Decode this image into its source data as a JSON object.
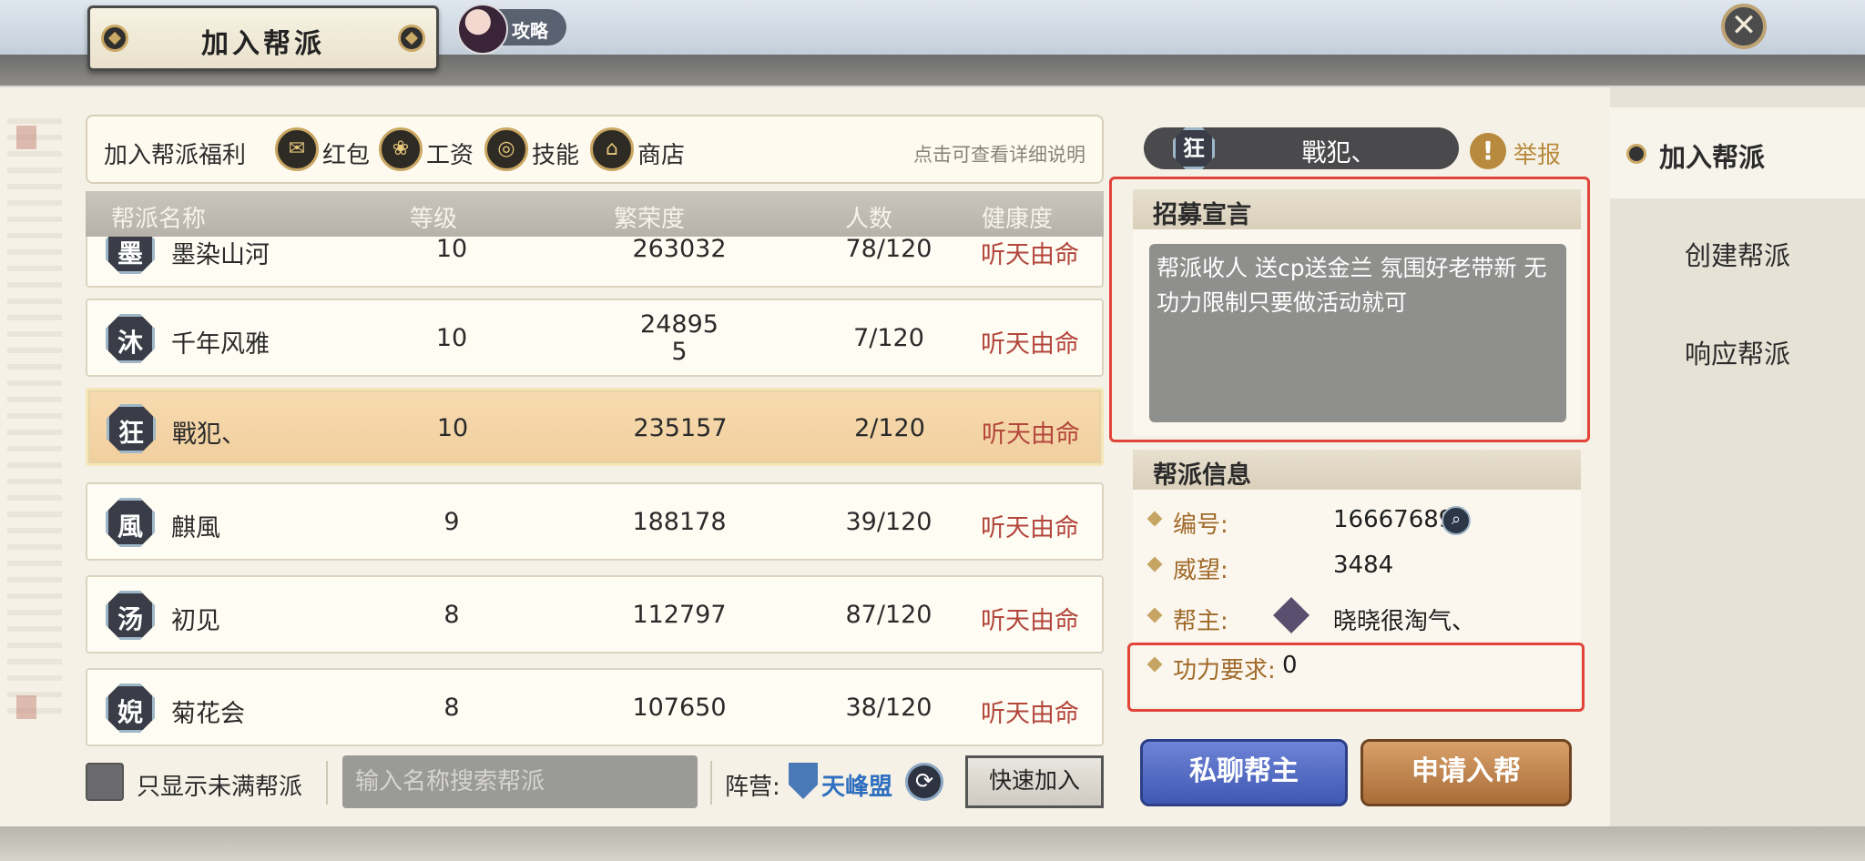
{
  "header": {
    "title": "加入帮派",
    "guide_label": "攻略",
    "close_symbol": "✕"
  },
  "benefits": {
    "label": "加入帮派福利",
    "items": [
      {
        "icon": "red-envelope-icon",
        "glyph": "✉",
        "label": "红包"
      },
      {
        "icon": "money-bag-icon",
        "glyph": "❀",
        "label": "工资"
      },
      {
        "icon": "skill-swirl-icon",
        "glyph": "◎",
        "label": "技能"
      },
      {
        "icon": "shop-icon",
        "glyph": "⌂",
        "label": "商店"
      }
    ],
    "hint": "点击可查看详细说明"
  },
  "list": {
    "columns": [
      "帮派名称",
      "等级",
      "繁荣度",
      "人数",
      "健康度"
    ],
    "rows": [
      {
        "emblem": "墨",
        "name": "墨染山河",
        "level": "10",
        "prosperity": "263032",
        "members": "78/120",
        "health": "听天由命"
      },
      {
        "emblem": "沐",
        "name": "千年风雅",
        "level": "10",
        "prosperity": "24895\n5",
        "members": "7/120",
        "health": "听天由命"
      },
      {
        "emblem": "狂",
        "name": "戰犯、",
        "level": "10",
        "prosperity": "235157",
        "members": "2/120",
        "health": "听天由命",
        "selected": true
      },
      {
        "emblem": "風",
        "name": "麒風",
        "level": "9",
        "prosperity": "188178",
        "members": "39/120",
        "health": "听天由命"
      },
      {
        "emblem": "汤",
        "name": "初见",
        "level": "8",
        "prosperity": "112797",
        "members": "87/120",
        "health": "听天由命"
      },
      {
        "emblem": "婗",
        "name": "菊花会",
        "level": "8",
        "prosperity": "107650",
        "members": "38/120",
        "health": "听天由命"
      }
    ]
  },
  "filters": {
    "only_not_full_label": "只显示未满帮派",
    "search_placeholder": "输入名称搜索帮派",
    "camp_label": "阵营:",
    "camp_name": "天峰盟",
    "quick_join_label": "快速加入"
  },
  "detail": {
    "emblem": "狂",
    "name": "戰犯、",
    "report_icon": "!",
    "report_label": "举报",
    "recruit_title": "招募宣言",
    "recruit_text": "帮派收人 送cp送金兰 氛围好老带新 无功力限制只要做活动就可",
    "info_title": "帮派信息",
    "info": {
      "id_label": "编号:",
      "id_value": "16667689",
      "prestige_label": "威望:",
      "prestige_value": "3484",
      "leader_label": "帮主:",
      "leader_value": "晓晓很淘气、",
      "power_label": "功力要求:",
      "power_value": "0"
    },
    "chat_leader_label": "私聊帮主",
    "apply_label": "申请入帮"
  },
  "side_tabs": [
    {
      "label": "加入帮派",
      "active": true
    },
    {
      "label": "创建帮派",
      "active": false
    },
    {
      "label": "响应帮派",
      "active": false
    }
  ],
  "colors": {
    "health_text": "#b2463c",
    "highlight_box": "#e2443a",
    "chat_button": "#3f58b3",
    "apply_button": "#a96d38"
  }
}
